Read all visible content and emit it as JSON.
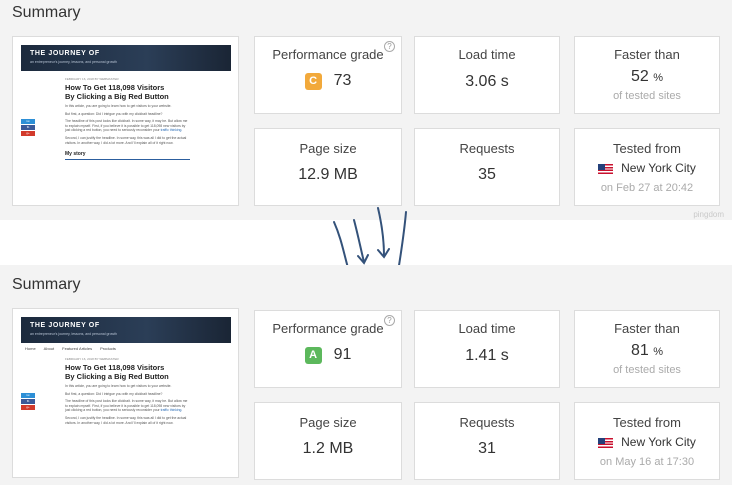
{
  "colors": {
    "panel_bg": "#f3f3f3",
    "grade_c": "#f2a93b",
    "grade_a": "#5cb85c",
    "arrow": "#34527a"
  },
  "before": {
    "title": "Summary",
    "performance": {
      "label": "Performance grade",
      "grade": "C",
      "grade_color": "#f2a93b",
      "score": "73",
      "help_icon": "?"
    },
    "load_time": {
      "label": "Load time",
      "value": "3.06 s"
    },
    "faster_than": {
      "label": "Faster than",
      "value": "52",
      "unit": "%",
      "sub": "of tested sites"
    },
    "page_size": {
      "label": "Page size",
      "value": "12.9 MB"
    },
    "requests": {
      "label": "Requests",
      "value": "35"
    },
    "tested_from": {
      "label": "Tested from",
      "location": "New York City",
      "flag_icon": "us-flag-icon",
      "date": "on Feb 27 at 20:42"
    },
    "watermark": "pingdom"
  },
  "after": {
    "title": "Summary",
    "performance": {
      "label": "Performance grade",
      "grade": "A",
      "grade_color": "#5cb85c",
      "score": "91",
      "help_icon": "?"
    },
    "load_time": {
      "label": "Load time",
      "value": "1.41 s"
    },
    "faster_than": {
      "label": "Faster than",
      "value": "81",
      "unit": "%",
      "sub": "of tested sites"
    },
    "page_size": {
      "label": "Page size",
      "value": "1.2 MB"
    },
    "requests": {
      "label": "Requests",
      "value": "31"
    },
    "tested_from": {
      "label": "Tested from",
      "location": "New York City",
      "flag_icon": "us-flag-icon",
      "date": "on May 16 at 17:30"
    }
  },
  "thumbnail": {
    "brand": "THE JOURNEY OF",
    "tagline": "an entrepreneur's journey, lessons, and personal growth",
    "nav": [
      "Home",
      "About",
      "Featured Articles",
      "Products"
    ],
    "date": "FEBRUARY 16, 2018 BY WEBMASTER",
    "headline_1": "How To Get 118,098 Visitors",
    "headline_2": "By Clicking a Big Red Button",
    "para_1": "In this article, you are going to learn how to get visitors to your website.",
    "para_2": "But first, a question: Did I intrigue you with my clickbait headline?",
    "para_3": "The headline of this post looks like clickbait. In some way, it may be. But allow me to explain myself. First, if you believe it is possible to get 118,098 new visitors by just clicking a red button, you need to seriously reconsider your",
    "para_3_link": "traffic thinking.",
    "para_4": "Second, I can justify the headline. In some way, this was all I did to get the actual visitors. In another way, I did a lot more. And I'll explain all of it right now.",
    "story": "My story",
    "share": [
      "tw",
      "fb",
      "g+"
    ]
  }
}
